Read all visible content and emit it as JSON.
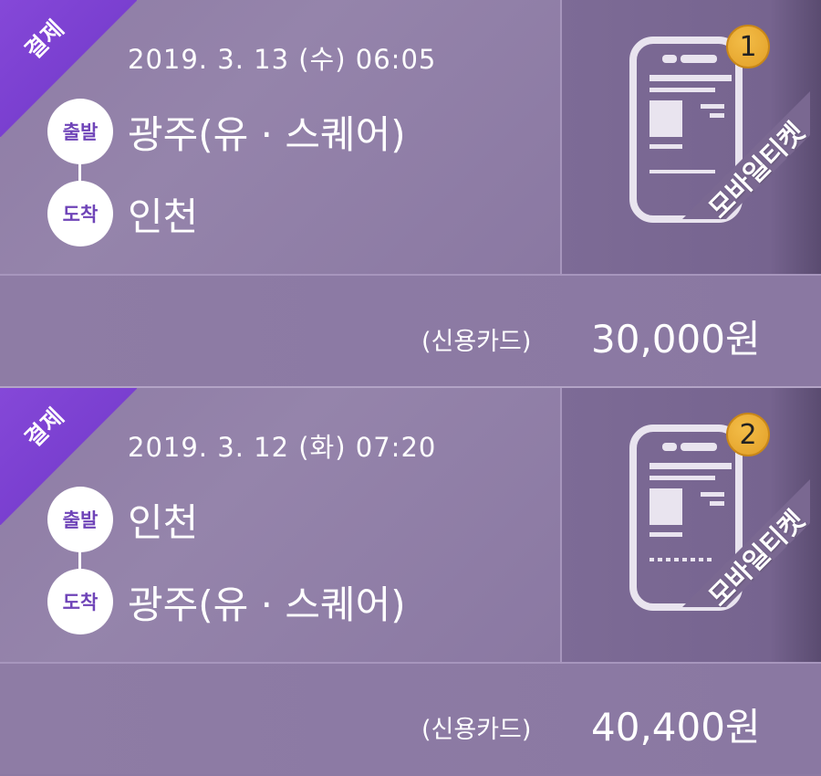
{
  "bookings": [
    {
      "status": "결제",
      "datetime": "2019. 3. 13 (수) 06:05",
      "departure_label": "출발",
      "arrival_label": "도착",
      "departure": "광주(유 · 스퀘어)",
      "arrival": "인천",
      "payment_method": "(신용카드)",
      "amount": "30,000원",
      "ticket_type": "모바일티켓",
      "ticket_count": "1"
    },
    {
      "status": "결제",
      "datetime": "2019. 3. 12 (화) 07:20",
      "departure_label": "출발",
      "arrival_label": "도착",
      "departure": "인천",
      "arrival": "광주(유 · 스퀘어)",
      "payment_method": "(신용카드)",
      "amount": "40,400원",
      "ticket_type": "모바일티켓",
      "ticket_count": "2"
    }
  ],
  "colors": {
    "ribbon": "#8548d8",
    "badge": "#e8a934",
    "circle_text": "#6f44b8",
    "background": "#8c7aa3"
  },
  "icons": {
    "ticket": "mobile-phone-ticket-icon"
  }
}
